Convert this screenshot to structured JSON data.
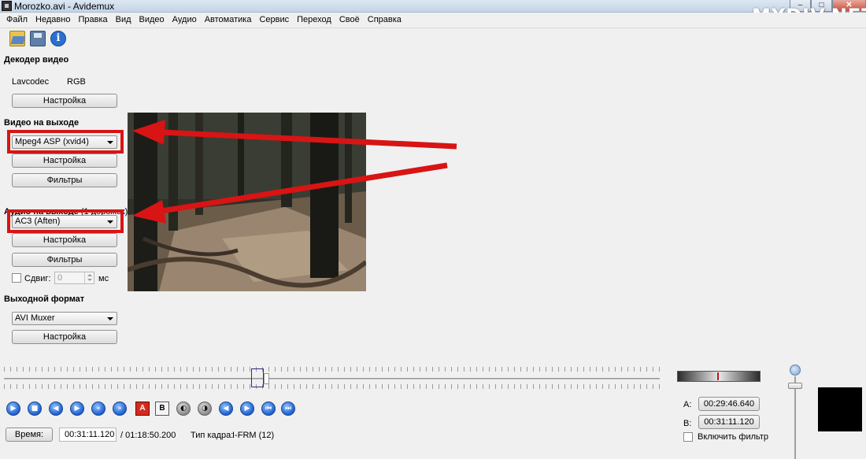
{
  "window": {
    "title": "Morozko.avi - Avidemux"
  },
  "watermark": "MYDIV.NET",
  "menu": [
    "Файл",
    "Недавно",
    "Правка",
    "Вид",
    "Видео",
    "Аудио",
    "Автоматика",
    "Сервис",
    "Переход",
    "Своё",
    "Справка"
  ],
  "toolbar": {
    "icons": [
      "folder-open-icon",
      "floppy-save-icon",
      "info-icon"
    ]
  },
  "video_decoder": {
    "title": "Декодер видео",
    "codec": "Lavcodec",
    "format": "RGB",
    "settings_label": "Настройка"
  },
  "video_output": {
    "title": "Видео на выходе",
    "selected": "Mpeg4 ASP (xvid4)",
    "settings_label": "Настройка",
    "filters_label": "Фильтры"
  },
  "audio_output": {
    "title": "Аудио на выходе",
    "tracks_note": "(1 дорожек)",
    "selected": "AC3 (Aften)",
    "settings_label": "Настройка",
    "filters_label": "Фильтры",
    "shift_label": "Сдвиг:",
    "shift_value": "0",
    "shift_unit": "мс"
  },
  "output_format": {
    "title": "Выходной формат",
    "selected": "AVI Muxer",
    "settings_label": "Настройка"
  },
  "timeline": {
    "position_fraction": 0.394
  },
  "controls": {
    "icons": [
      "play-icon",
      "stop-icon",
      "prev-frame-icon",
      "next-frame-icon",
      "prev-keyframe-icon",
      "next-keyframe-icon",
      "marker-a-icon",
      "marker-b-icon",
      "prev-cut-icon",
      "next-cut-icon",
      "goto-marker-a-icon",
      "goto-marker-b-icon",
      "first-frame-icon",
      "last-frame-icon"
    ],
    "marker_a_glyph": "A",
    "marker_b_glyph": "B"
  },
  "status": {
    "time_button": "Время:",
    "current_time": "00:31:11.120",
    "total_time": "/ 01:18:50.200",
    "frame_type_label": "Тип кадра:",
    "frame_type_value": "I-FRM (12)"
  },
  "selection": {
    "a_label": "A:",
    "a_value": "00:29:46.640",
    "b_label": "B:",
    "b_value": "00:31:11.120",
    "filter_label": "Включить фильтр"
  },
  "colors": {
    "highlight": "#d81414",
    "accent_blue": "#1d5fcf"
  }
}
